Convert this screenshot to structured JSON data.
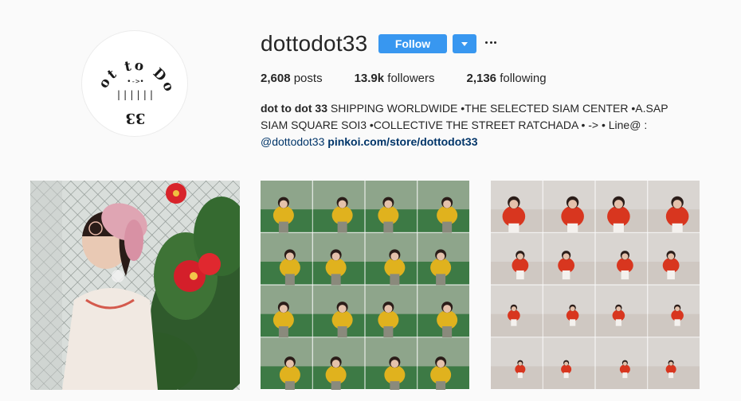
{
  "profile": {
    "username": "dottodot33",
    "avatar_text": {
      "top": "Dot to Dot",
      "middle": "•->•",
      "bottom": "33",
      "bars": "||||||"
    }
  },
  "actions": {
    "follow_label": "Follow",
    "dropdown_icon": "chevron-down-icon",
    "more_icon": "ellipsis-icon"
  },
  "stats": {
    "posts_count": "2,608",
    "posts_label": "posts",
    "followers_count": "13.9k",
    "followers_label": "followers",
    "following_count": "2,136",
    "following_label": "following"
  },
  "bio": {
    "name": "dot to dot 33",
    "line1_text": "SHIPPING WORLDWIDE •THE SELECTED SIAM CENTER •A.SAP",
    "line2_text": "SIAM SQUARE SOI3 •COLLECTIVE THE STREET RATCHADA • -> • Line@ :",
    "handle": "@dottodot33",
    "website": "pinkoi.com/store/dottodot33"
  },
  "posts": [
    {
      "kind": "photo",
      "subject": "girl in pink beret beside red hibiscus flowers"
    },
    {
      "kind": "collage",
      "subject": "girl in yellow sweater on green court"
    },
    {
      "kind": "collage",
      "subject": "girl in red sweater in front of shutter"
    }
  ],
  "colors": {
    "accent": "#3897f0",
    "link": "#003569",
    "text": "#262626",
    "background": "#fafafa"
  }
}
